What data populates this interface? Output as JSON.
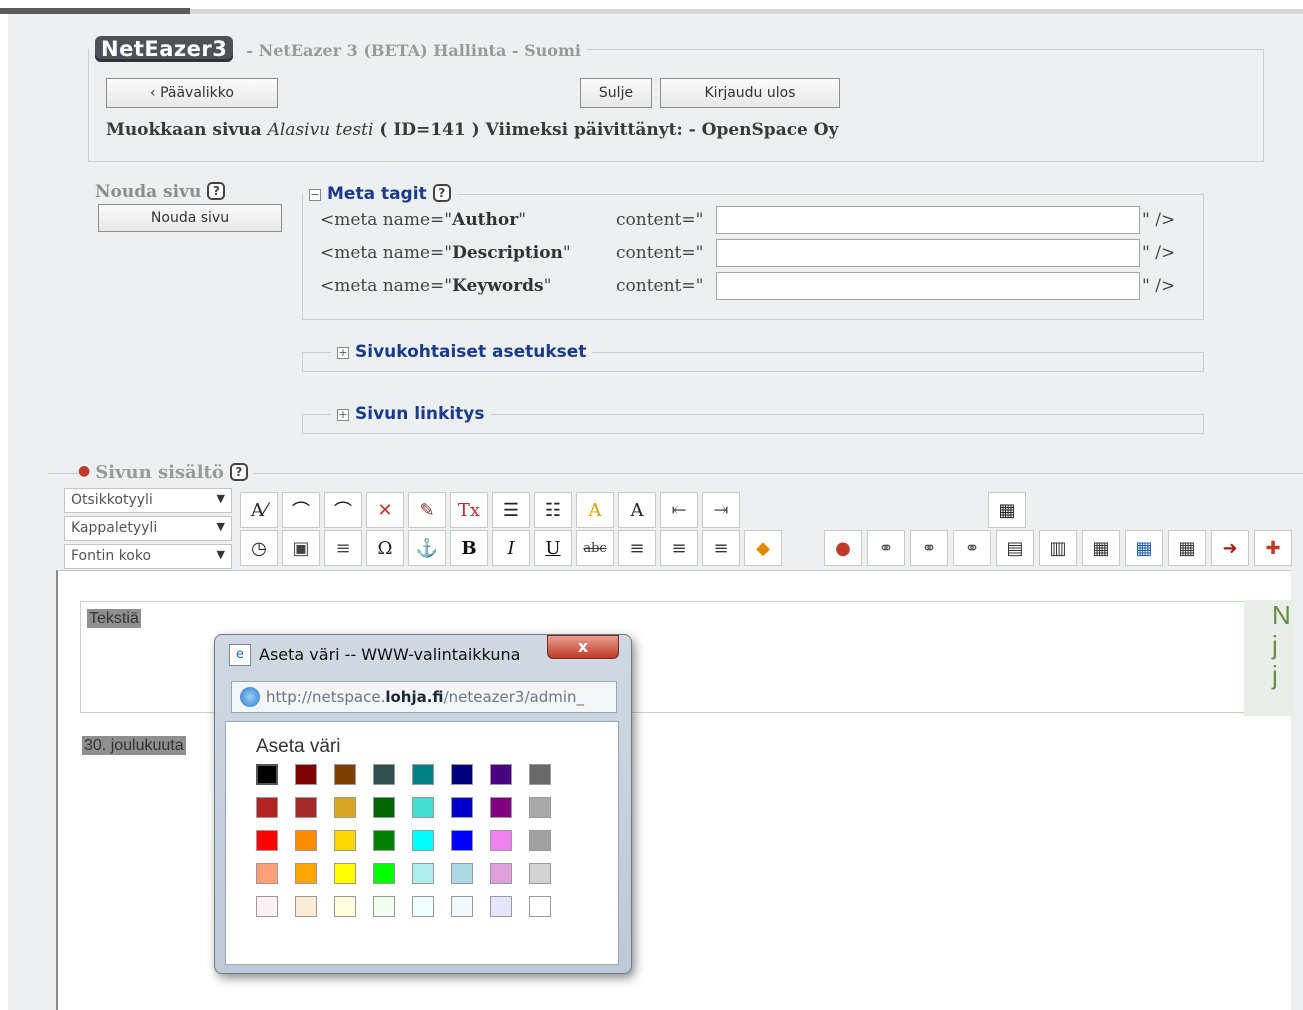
{
  "header": {
    "logo": "NetEazer3",
    "title": "- NetEazer 3 (BETA) Hallinta - Suomi",
    "back_button": "‹ Päävalikko",
    "close_button": "Sulje",
    "logout_button": "Kirjaudu ulos",
    "edit_prefix": "Muokkaan sivua",
    "page_name": "Alasivu testi",
    "edit_suffix": "( ID=141 ) Viimeksi päivittänyt: - OpenSpace Oy"
  },
  "fetch": {
    "legend": "Nouda sivu",
    "button": "Nouda sivu"
  },
  "meta": {
    "legend": "Meta tagit",
    "rows": [
      {
        "prefix": "<meta name=\"",
        "name": "Author",
        "suffix": "\"",
        "content_label": "content=\"",
        "value": "",
        "close": "\" />"
      },
      {
        "prefix": "<meta name=\"",
        "name": "Description",
        "suffix": "\"",
        "content_label": "content=\"",
        "value": "",
        "close": "\" />"
      },
      {
        "prefix": "<meta name=\"",
        "name": "Keywords",
        "suffix": "\"",
        "content_label": "content=\"",
        "value": "",
        "close": "\" />"
      }
    ]
  },
  "sections": {
    "page_settings": "Sivukohtaiset asetukset",
    "page_linking": "Sivun linkitys"
  },
  "content": {
    "legend": "Sivun sisältö",
    "heading_style": "Otsikkotyyli",
    "paragraph_style": "Kappaletyyli",
    "font_size": "Fontin koko",
    "text_selected": "Tekstiä",
    "date_text": "30. joulukuuta",
    "side_text": [
      "N",
      "j",
      "j"
    ]
  },
  "toolbar": {
    "row1": [
      "spellcheck-icon",
      "undo-icon",
      "redo-icon",
      "delete-icon",
      "cleanup-icon",
      "remove-format-icon",
      "bullet-list-icon",
      "numbered-list-icon",
      "text-color-icon",
      "bg-color-icon",
      "outdent-icon",
      "indent-icon"
    ],
    "row1_extra": "select-all-icon",
    "row2": [
      "clock-icon",
      "paste-icon",
      "horizontal-rule-icon",
      "omega-icon",
      "anchor-icon",
      "bold-icon",
      "italic-icon",
      "underline-icon",
      "strikethrough-icon",
      "align-left-icon",
      "align-center-icon",
      "align-right-icon",
      "image-icon",
      "link-icon",
      "unlink-icon",
      "link-edit-icon",
      "link-remove-icon",
      "insert-table-icon",
      "table-props-icon",
      "table-row-icon",
      "table-col-icon",
      "table-cell-icon",
      "exit-icon",
      "flag-icon"
    ],
    "row2_glyphs": {
      "omega": "Ω",
      "anchor": "⚓",
      "bold": "B",
      "italic": "I",
      "underline": "U",
      "strike": "abc"
    }
  },
  "dialog": {
    "title": "Aseta väri -- WWW-valintaikkuna",
    "close": "x",
    "url_prefix": "http://netspace.",
    "url_domain": "lohja.fi",
    "url_path": "/neteazer3/admin_",
    "heading": "Aseta väri",
    "colors": [
      [
        "#000000",
        "#7f0000",
        "#7f3f00",
        "#2f4f4f",
        "#008080",
        "#00007f",
        "#4b0082",
        "#696969"
      ],
      [
        "#b22222",
        "#a52a2a",
        "#daa520",
        "#006400",
        "#40e0d0",
        "#0000cd",
        "#800080",
        "#a9a9a9"
      ],
      [
        "#ff0000",
        "#ff8c00",
        "#ffd700",
        "#008000",
        "#00ffff",
        "#0000ff",
        "#ee82ee",
        "#a0a0a0"
      ],
      [
        "#ffa07a",
        "#ffa500",
        "#ffff00",
        "#00ff00",
        "#afeeee",
        "#add8e6",
        "#dda0dd",
        "#d3d3d3"
      ],
      [
        "#fff0f5",
        "#faebd7",
        "#ffffe0",
        "#f0fff0",
        "#f0ffff",
        "#f0f8ff",
        "#e6e6fa",
        "#ffffff"
      ]
    ]
  }
}
